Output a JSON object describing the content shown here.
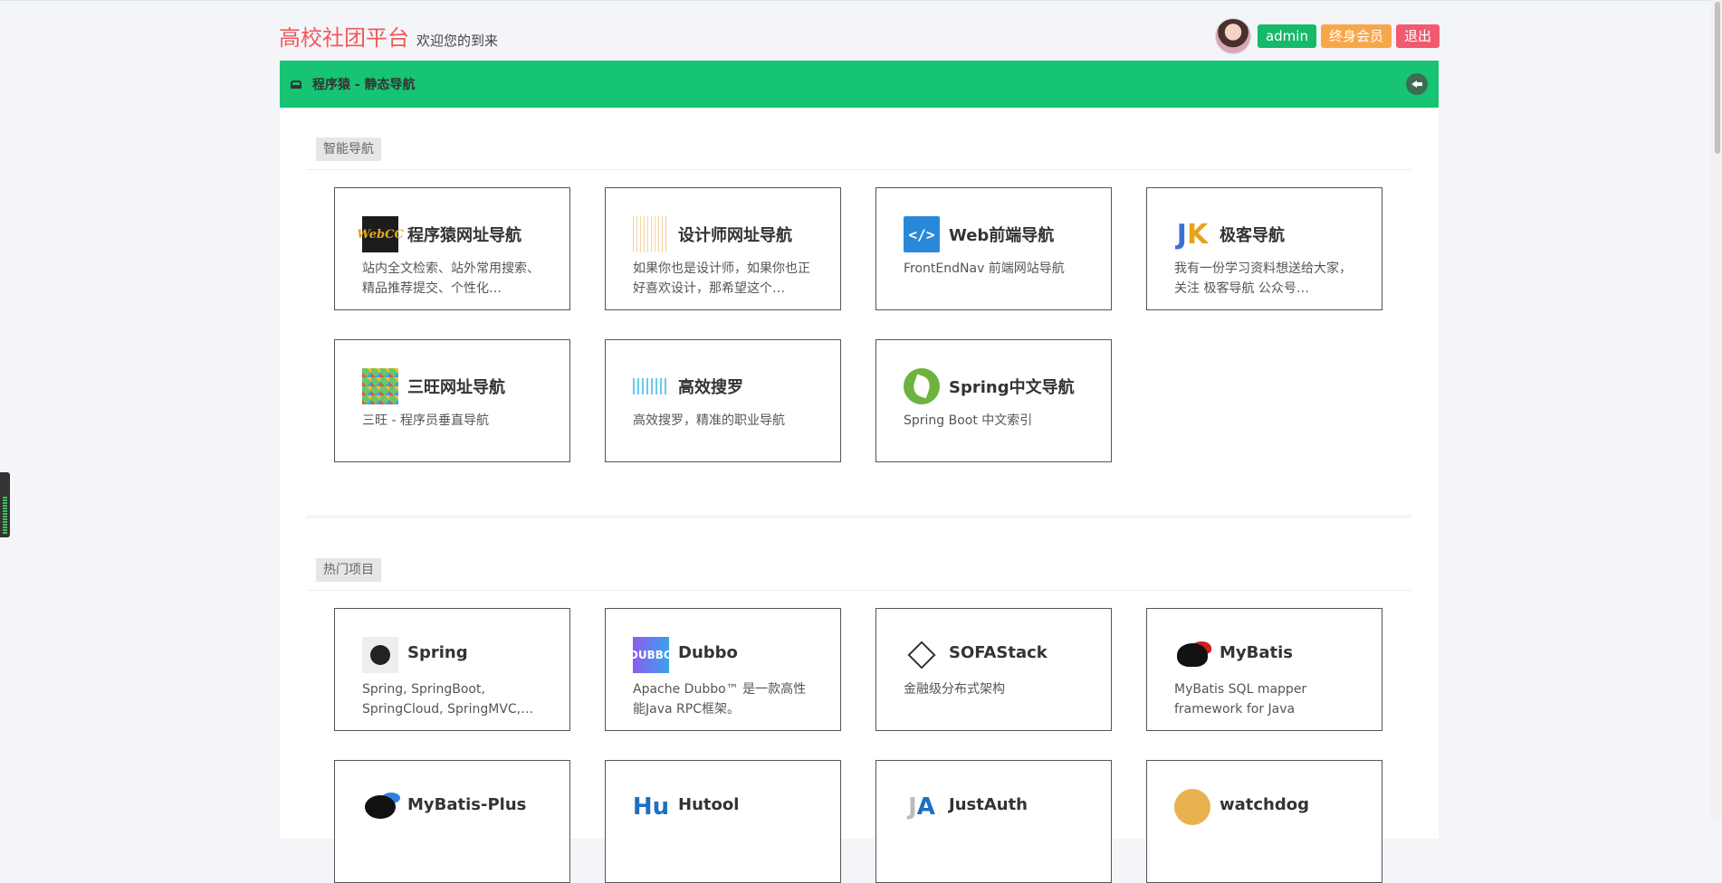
{
  "header": {
    "title": "高校社团平台",
    "subtitle": "欢迎您的到来",
    "user_name": "admin",
    "member_label": "终身会员",
    "logout_label": "退出"
  },
  "nav": {
    "title": "程序猿 - 静态导航"
  },
  "sections": [
    {
      "label": "智能导航",
      "cards": [
        {
          "title": "程序猿网址导航",
          "desc": "站内全文检索、站外常用搜索、精品推荐提交、个性化…",
          "icon": "webcc-logo-icon"
        },
        {
          "title": "设计师网址导航",
          "desc": "如果你也是设计师，如果你也正好喜欢设计，那希望这个…",
          "icon": "designer-logo-icon"
        },
        {
          "title": "Web前端导航",
          "desc": "FrontEndNav 前端网站导航",
          "icon": "code-brackets-icon"
        },
        {
          "title": "极客导航",
          "desc": "我有一份学习资料想送给大家，关注 极客导航 公众号…",
          "icon": "jk-logo-icon"
        },
        {
          "title": "三旺网址导航",
          "desc": "三旺 - 程序员垂直导航",
          "icon": "sanwang-logo-icon"
        },
        {
          "title": "高效搜罗",
          "desc": "高效搜罗，精准的职业导航",
          "icon": "gaoxiao-logo-icon"
        },
        {
          "title": "Spring中文导航",
          "desc": "Spring Boot 中文索引",
          "icon": "spring-leaf-icon"
        }
      ]
    },
    {
      "label": "热门项目",
      "cards": [
        {
          "title": "Spring",
          "desc": "Spring, SpringBoot, SpringCloud, SpringMVC,…",
          "icon": "spring-logo-icon"
        },
        {
          "title": "Dubbo",
          "desc": "Apache Dubbo™ 是一款高性能Java RPC框架。",
          "icon": "dubbo-logo-icon"
        },
        {
          "title": "SOFAStack",
          "desc": "金融级分布式架构",
          "icon": "sofastack-logo-icon"
        },
        {
          "title": "MyBatis",
          "desc": "MyBatis SQL mapper framework for Java",
          "icon": "mybatis-bird-icon"
        },
        {
          "title": "MyBatis-Plus",
          "desc": "",
          "icon": "mybatis-plus-icon"
        },
        {
          "title": "Hutool",
          "desc": "",
          "icon": "hutool-logo-icon"
        },
        {
          "title": "JustAuth",
          "desc": "",
          "icon": "justauth-logo-icon"
        },
        {
          "title": "watchdog",
          "desc": "",
          "icon": "watchdog-logo-icon"
        }
      ]
    }
  ],
  "logo_text": {
    "webcc": "WebCC",
    "web": "</>",
    "jk_j": "J",
    "jk_k": "K",
    "dubbo": "DUBBO",
    "hutool": "Hu",
    "justauth_j": "J",
    "justauth_a": "A"
  },
  "colors": {
    "brand": "#f05a5a",
    "nav_green": "#16c473",
    "admin_pill": "#16b96a",
    "member_pill": "#f7a74a",
    "logout_pill": "#f05a6e"
  }
}
